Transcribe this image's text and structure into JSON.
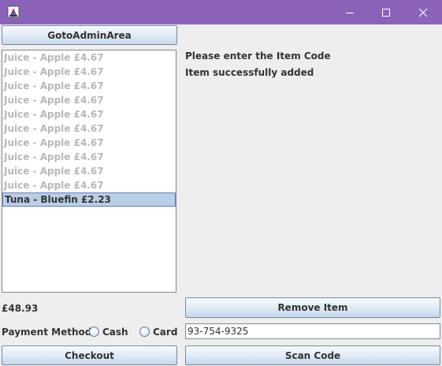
{
  "window": {
    "minimize_icon": "minimize-icon",
    "maximize_icon": "maximize-icon",
    "close_icon": "close-icon"
  },
  "buttons": {
    "goto_admin": "GotoAdminArea",
    "remove_item": "Remove Item",
    "checkout": "Checkout",
    "scan_code": "Scan Code"
  },
  "basket": {
    "items": [
      "Juice - Apple £4.67",
      "Juice - Apple £4.67",
      "Juice - Apple £4.67",
      "Juice - Apple £4.67",
      "Juice - Apple £4.67",
      "Juice - Apple £4.67",
      "Juice - Apple £4.67",
      "Juice - Apple £4.67",
      "Juice - Apple £4.67",
      "Juice - Apple £4.67",
      "Tuna - Bluefin £2.23"
    ],
    "selected_index": 10,
    "total": "£48.93"
  },
  "messages": {
    "prompt": "Please enter the Item Code",
    "status": "Item successfully added"
  },
  "payment": {
    "label": "Payment Method:",
    "options": [
      "Cash",
      "Card"
    ],
    "selected": null
  },
  "item_code_input": {
    "value": "93-754-9325"
  },
  "colors": {
    "titlebar": "#8a63b8",
    "selection": "#b8cfe5",
    "background": "#eeeeee"
  }
}
